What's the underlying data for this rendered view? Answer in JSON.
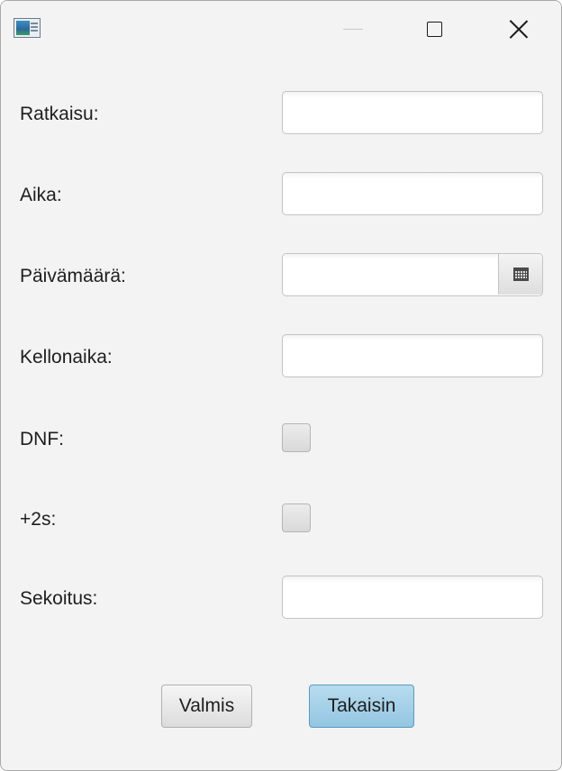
{
  "window": {
    "title": "",
    "controls": {
      "minimize_icon": "minimize-icon",
      "maximize_icon": "maximize-icon",
      "close_icon": "close-icon"
    }
  },
  "form": {
    "ratkaisu_label": "Ratkaisu:",
    "ratkaisu_value": "",
    "aika_label": "Aika:",
    "aika_value": "",
    "paivamaara_label": "Päivämäärä:",
    "paivamaara_value": "",
    "kellonaika_label": "Kellonaika:",
    "kellonaika_value": "",
    "dnf_label": "DNF:",
    "dnf_checked": false,
    "plus2_label": "+2s:",
    "plus2_checked": false,
    "sekoitus_label": "Sekoitus:",
    "sekoitus_value": ""
  },
  "buttons": {
    "valmis_label": "Valmis",
    "takaisin_label": "Takaisin"
  },
  "colors": {
    "window_bg": "#f3f3f3",
    "default_button_bg": "#a6d1e8",
    "default_button_border": "#5a9ac0"
  }
}
